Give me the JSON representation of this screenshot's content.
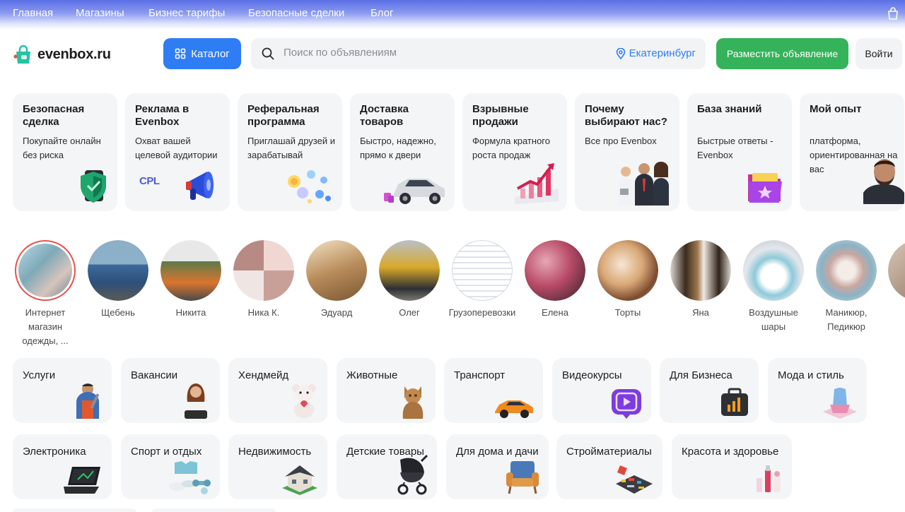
{
  "topnav": {
    "items": [
      "Главная",
      "Магазины",
      "Бизнес тарифы",
      "Безопасные сделки",
      "Блог"
    ]
  },
  "header": {
    "logo_text": "evenbox.ru",
    "catalog_label": "Каталог",
    "search_placeholder": "Поиск по объявлениям",
    "search_value": "",
    "city": "Екатеринбург",
    "post_button": "Разместить объявление",
    "login_button": "Войти"
  },
  "promos": [
    {
      "title": "Безопасная сделка",
      "desc": "Покупайте онлайн без риска",
      "icon": "shield-icon"
    },
    {
      "title": "Реклама в Evenbox",
      "desc": "Охват вашей целевой аудитории",
      "icon": "megaphone-icon",
      "badge": "CPL"
    },
    {
      "title": "Реферальная программа",
      "desc": "Приглашай друзей и зарабатывай",
      "icon": "coins-icon"
    },
    {
      "title": "Доставка товаров",
      "desc": "Быстро, надежно, прямо к двери",
      "icon": "car-icon"
    },
    {
      "title": "Взрывные продажи",
      "desc": "Формула кратного роста продаж",
      "icon": "growth-chart-icon"
    },
    {
      "title": "Почему выбирают нас?",
      "desc": "Все про Evenbox",
      "icon": "team-icon"
    },
    {
      "title": "База знаний",
      "desc": "Быстрые ответы - Evenbox",
      "icon": "folder-icon"
    },
    {
      "title": "Мой опыт",
      "desc": "платформа, ориентированная на вас",
      "icon": "person-photo-icon"
    }
  ],
  "stories": [
    {
      "label": "Интернет магазин одежды, ...",
      "active": true
    },
    {
      "label": "Щебень"
    },
    {
      "label": "Никита"
    },
    {
      "label": "Ника К."
    },
    {
      "label": "Эдуард"
    },
    {
      "label": "Олег"
    },
    {
      "label": "Грузоперевозки"
    },
    {
      "label": "Елена"
    },
    {
      "label": "Торты"
    },
    {
      "label": "Яна"
    },
    {
      "label": "Воздушные шары"
    },
    {
      "label": "Маникюр, Педикюр"
    }
  ],
  "categories_row1": [
    {
      "label": "Услуги",
      "icon": "worker-icon"
    },
    {
      "label": "Вакансии",
      "icon": "woman-icon"
    },
    {
      "label": "Хендмейд",
      "icon": "teddy-bear-icon"
    },
    {
      "label": "Животные",
      "icon": "cat-icon"
    },
    {
      "label": "Транспорт",
      "icon": "car-icon"
    },
    {
      "label": "Видеокурсы",
      "icon": "video-play-icon"
    },
    {
      "label": "Для Бизнеса",
      "icon": "briefcase-icon"
    },
    {
      "label": "Мода и стиль",
      "icon": "fashion-icon"
    }
  ],
  "categories_row2": [
    {
      "label": "Электроника",
      "icon": "laptop-icon"
    },
    {
      "label": "Спорт и отдых",
      "icon": "sport-icon"
    },
    {
      "label": "Недвижимость",
      "icon": "house-icon"
    },
    {
      "label": "Детские товары",
      "icon": "stroller-icon"
    },
    {
      "label": "Для дома и дачи",
      "icon": "armchair-icon"
    },
    {
      "label": "Стройматериалы",
      "icon": "tools-icon"
    },
    {
      "label": "Красота и здоровье",
      "icon": "cosmetics-icon"
    }
  ]
}
